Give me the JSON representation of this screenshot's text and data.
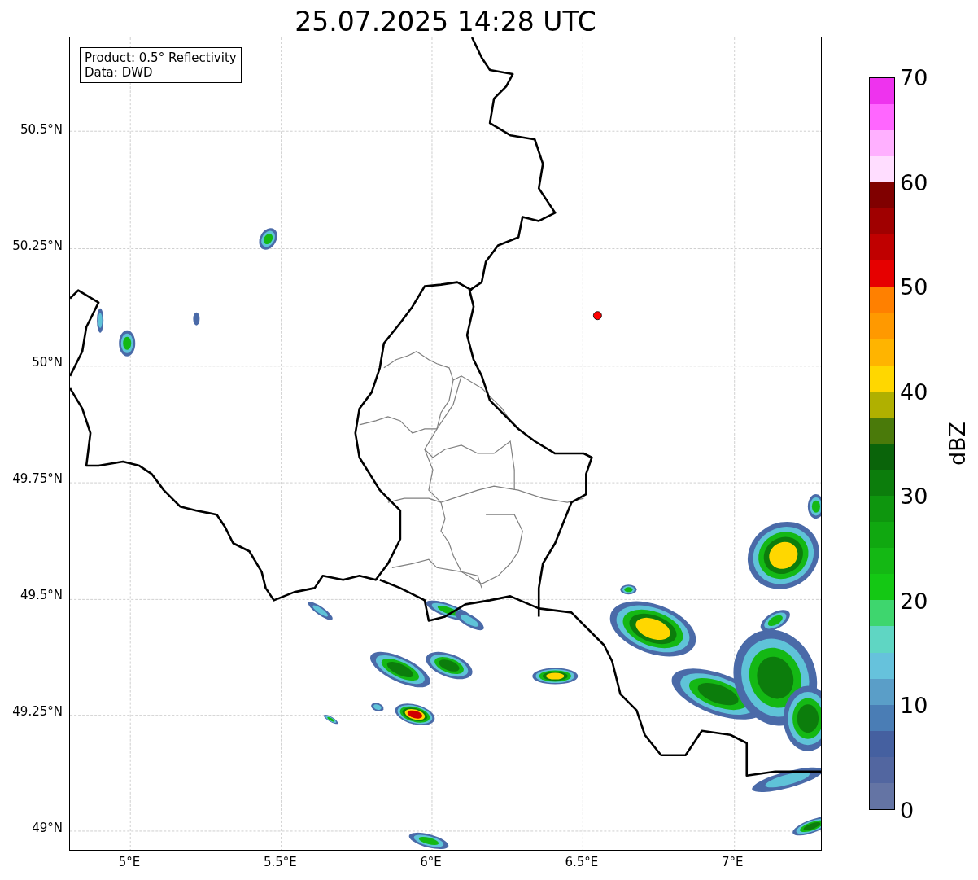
{
  "title": "25.07.2025 14:28 UTC",
  "info_box": {
    "lines": [
      "Product: 0.5° Reflectivity",
      "Data: DWD"
    ]
  },
  "y_ticks": [
    "50.5°N",
    "50.25°N",
    "50°N",
    "49.75°N",
    "49.5°N",
    "49.25°N",
    "49°N"
  ],
  "x_ticks": [
    "5°E",
    "5.5°E",
    "6°E",
    "6.5°E",
    "7°E"
  ],
  "colorbar": {
    "label": "dBZ",
    "ticks": [
      "70",
      "60",
      "50",
      "40",
      "30",
      "20",
      "10",
      "0"
    ],
    "bins": [
      {
        "color": "#6474a4"
      },
      {
        "color": "#5266a0"
      },
      {
        "color": "#4560a0"
      },
      {
        "color": "#4a7db5"
      },
      {
        "color": "#5a9ec8"
      },
      {
        "color": "#66c2dc"
      },
      {
        "color": "#5fd6c3"
      },
      {
        "color": "#3ed66e"
      },
      {
        "color": "#14c814"
      },
      {
        "color": "#14b814"
      },
      {
        "color": "#10a810"
      },
      {
        "color": "#0e960e"
      },
      {
        "color": "#0c7d0c"
      },
      {
        "color": "#0a640a"
      },
      {
        "color": "#4a7a0a"
      },
      {
        "color": "#b0b000"
      },
      {
        "color": "#ffd700"
      },
      {
        "color": "#ffb400"
      },
      {
        "color": "#ff9900"
      },
      {
        "color": "#ff8000"
      },
      {
        "color": "#e60000"
      },
      {
        "color": "#c00000"
      },
      {
        "color": "#a00000"
      },
      {
        "color": "#800000"
      },
      {
        "color": "#ffddff"
      },
      {
        "color": "#ffb0ff"
      },
      {
        "color": "#ff66ff"
      },
      {
        "color": "#ee33ee"
      }
    ]
  }
}
